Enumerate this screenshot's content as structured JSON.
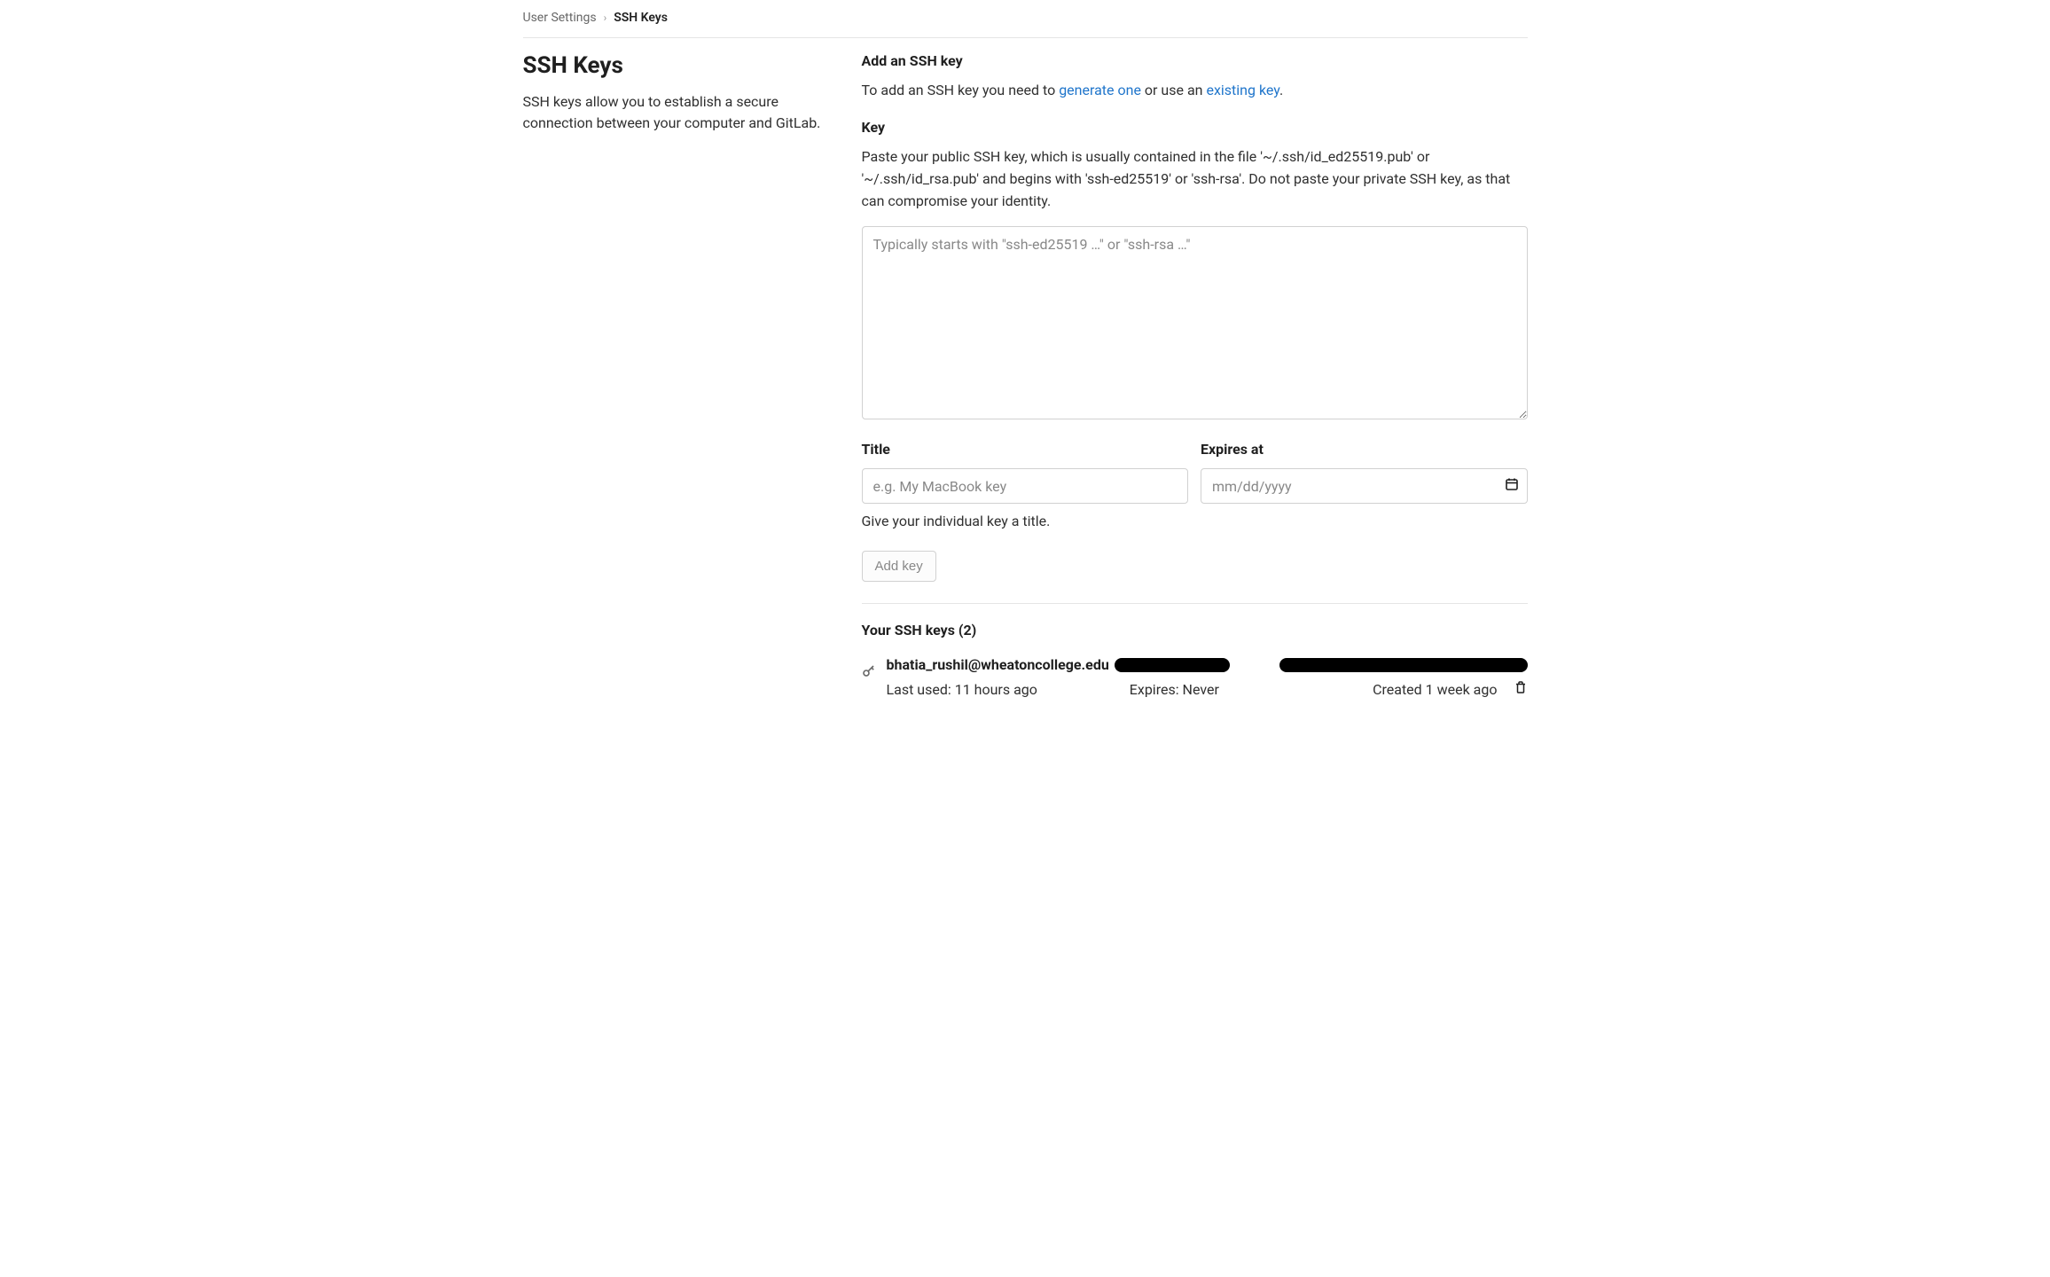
{
  "breadcrumb": {
    "parent": "User Settings",
    "current": "SSH Keys"
  },
  "sidebar": {
    "title": "SSH Keys",
    "description": "SSH keys allow you to establish a secure connection between your computer and GitLab."
  },
  "form": {
    "heading": "Add an SSH key",
    "intro_prefix": "To add an SSH key you need to ",
    "link_generate": "generate one",
    "intro_mid": " or use an ",
    "link_existing": "existing key",
    "intro_suffix": ".",
    "key_label": "Key",
    "key_help": "Paste your public SSH key, which is usually contained in the file '~/.ssh/id_ed25519.pub' or '~/.ssh/id_rsa.pub' and begins with 'ssh-ed25519' or 'ssh-rsa'. Do not paste your private SSH key, as that can compromise your identity.",
    "key_placeholder": "Typically starts with \"ssh-ed25519 …\" or \"ssh-rsa …\"",
    "title_label": "Title",
    "title_placeholder": "e.g. My MacBook key",
    "title_hint": "Give your individual key a title.",
    "expires_label": "Expires at",
    "expires_placeholder": "mm/dd/yyyy",
    "submit_label": "Add key"
  },
  "keys_list": {
    "heading": "Your SSH keys (2)",
    "items": [
      {
        "title": "bhatia_rushil@wheatoncollege.edu",
        "last_used": "Last used: 11 hours ago",
        "expires": "Expires: Never",
        "created": "Created 1 week ago"
      }
    ]
  }
}
